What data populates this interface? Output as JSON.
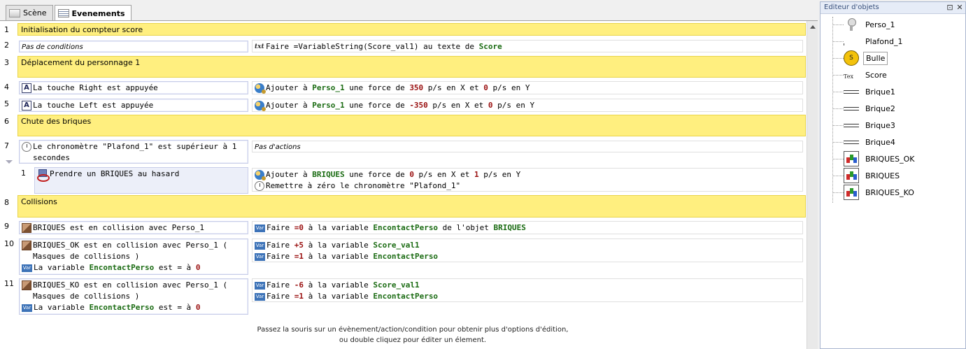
{
  "tabs": [
    {
      "label": "Scène",
      "icon": "scene-icon"
    },
    {
      "label": "Evenements",
      "icon": "events-icon",
      "active": true
    }
  ],
  "events": {
    "e1": {
      "num": "1",
      "comment": "Initialisation du compteur score"
    },
    "e2": {
      "num": "2",
      "cond": "Pas de conditions",
      "act_pre": "Faire =VariableString(Score_val1) au texte de ",
      "act_obj": "Score"
    },
    "e3": {
      "num": "3",
      "comment": "Déplacement du personnage 1"
    },
    "e4": {
      "num": "4",
      "cond": "La touche Right est appuyée",
      "a_pre": "Ajouter à ",
      "a_obj": "Perso_1",
      "a_mid": " une force de ",
      "a_x": "350",
      "a_mid2": " p/s en X et ",
      "a_y": "0",
      "a_end": " p/s en Y"
    },
    "e5": {
      "num": "5",
      "cond": "La touche Left est appuyée",
      "a_pre": "Ajouter à ",
      "a_obj": "Perso_1",
      "a_mid": " une force de ",
      "a_x": "-350",
      "a_mid2": " p/s en X et ",
      "a_y": "0",
      "a_end": " p/s en Y"
    },
    "e6": {
      "num": "6",
      "comment": "Chute des briques"
    },
    "e7": {
      "num": "7",
      "cond": "Le chronomètre \"Plafond_1\" est supérieur à 1 secondes",
      "act": "Pas d'actions"
    },
    "e7_1": {
      "num": "1",
      "cond": "Prendre un BRIQUES au hasard",
      "a_pre": "Ajouter à ",
      "a_obj": "BRIQUES",
      "a_mid": " une force de ",
      "a_x": "0",
      "a_mid2": " p/s en X et ",
      "a_y": "1",
      "a_end": " p/s en Y",
      "a2": "Remettre à zéro le chronomètre \"Plafond_1\""
    },
    "e8": {
      "num": "8",
      "comment": "Collisions"
    },
    "e9": {
      "num": "9",
      "cond": "BRIQUES est en collision avec Perso_1",
      "a_pre": "Faire ",
      "a_val": "=0",
      "a_mid": " à la variable ",
      "a_var": "EncontactPerso",
      "a_mid2": " de l'objet ",
      "a_obj": "BRIQUES"
    },
    "e10": {
      "num": "10",
      "cond": "BRIQUES_OK est en collision avec Perso_1 ( Masques de collisions )",
      "cond2_pre": "La variable ",
      "cond2_var": "EncontactPerso",
      "cond2_mid": " est = à ",
      "cond2_val": "0",
      "a1_pre": "Faire ",
      "a1_val": "+5",
      "a1_mid": " à la variable ",
      "a1_var": "Score_val1",
      "a2_pre": "Faire ",
      "a2_val": "=1",
      "a2_mid": " à la variable ",
      "a2_var": "EncontactPerso"
    },
    "e11": {
      "num": "11",
      "cond": "BRIQUES_KO est en collision avec Perso_1 ( Masques de collisions )",
      "cond2_pre": "La variable ",
      "cond2_var": "EncontactPerso",
      "cond2_mid": " est = à ",
      "cond2_val": "0",
      "a1_pre": "Faire ",
      "a1_val": "-6",
      "a1_mid": " à la variable ",
      "a1_var": "Score_val1",
      "a2_pre": "Faire ",
      "a2_val": "=1",
      "a2_mid": " à la variable ",
      "a2_var": "EncontactPerso"
    }
  },
  "hint": {
    "line1": "Passez la souris sur un évènement/action/condition pour obtenir plus d'options d'édition,",
    "line2": "ou double cliquez pour éditer un élement."
  },
  "object_editor": {
    "title": "Editeur d'objets",
    "pin": "⊡",
    "close": "✕",
    "objects": [
      "Perso_1",
      "Plafond_1",
      "Bulle",
      "Score",
      "Brique1",
      "Brique2",
      "Brique3",
      "Brique4",
      "BRIQUES_OK",
      "BRIQUES",
      "BRIQUES_KO"
    ],
    "bulle_letter": "S",
    "text_icon_letter": "T",
    "text_icon_sub": "ex"
  },
  "colors": {
    "comment_bg": "#ffef7f",
    "highlight_object": "#1a6b12",
    "highlight_number": "#9a1010"
  }
}
